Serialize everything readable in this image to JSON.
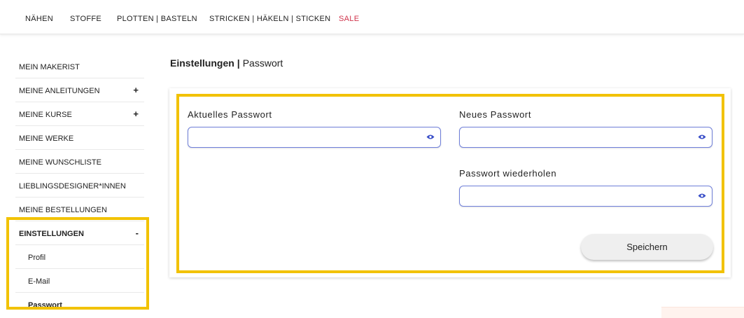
{
  "topnav": {
    "items": [
      "NÄHEN",
      "STOFFE",
      "PLOTTEN | BASTELN",
      "STRICKEN | HÄKELN | STICKEN",
      "SALE"
    ],
    "sale_color": "#d0344c"
  },
  "sidebar": {
    "items": [
      {
        "label": "MEIN MAKERIST",
        "toggle": ""
      },
      {
        "label": "MEINE ANLEITUNGEN",
        "toggle": "+"
      },
      {
        "label": "MEINE KURSE",
        "toggle": "+"
      },
      {
        "label": "MEINE WERKE",
        "toggle": ""
      },
      {
        "label": "MEINE WUNSCHLISTE",
        "toggle": ""
      },
      {
        "label": "LIEBLINGSDESIGNER*INNEN",
        "toggle": ""
      },
      {
        "label": "MEINE BESTELLUNGEN",
        "toggle": ""
      },
      {
        "label": "EINSTELLUNGEN",
        "toggle": "-"
      }
    ],
    "subitems": [
      {
        "label": "Profil"
      },
      {
        "label": "E-Mail"
      },
      {
        "label": "Passwort"
      }
    ]
  },
  "breadcrumb": {
    "section": "Einstellungen",
    "separator": "|",
    "page": "Passwort"
  },
  "form": {
    "current_label": "Aktuelles Passwort",
    "current_value": "",
    "new_label": "Neues Passwort",
    "new_value": "",
    "repeat_label": "Passwort wiederholen",
    "repeat_value": "",
    "save_label": "Speichern"
  },
  "colors": {
    "highlight": "#f2c200",
    "field_border": "#6f7fd9",
    "eye_icon": "#3a4fc8"
  }
}
